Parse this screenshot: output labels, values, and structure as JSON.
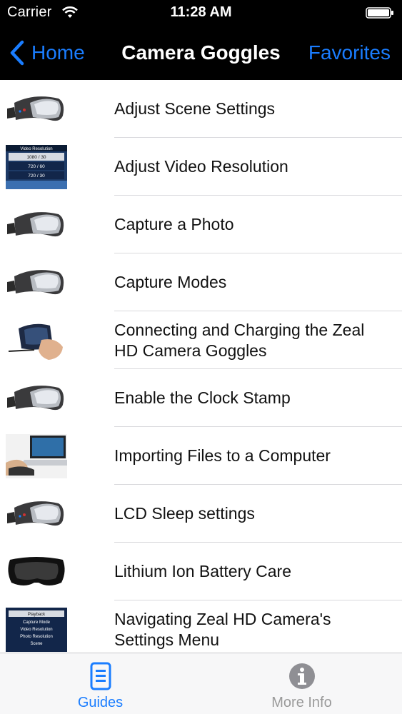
{
  "status_bar": {
    "carrier": "Carrier",
    "time": "11:28 AM"
  },
  "nav": {
    "back_label": "Home",
    "title": "Camera Goggles",
    "right_label": "Favorites"
  },
  "list": {
    "items": [
      {
        "label": "Adjust Scene Settings",
        "thumb": "goggles-icon"
      },
      {
        "label": "Adjust Video Resolution",
        "thumb": "resolution-menu-icon",
        "thumb_text": [
          "Video Resolution",
          "1080 / 30",
          "720 / 60",
          "720 / 30"
        ]
      },
      {
        "label": "Capture a Photo",
        "thumb": "goggles-icon"
      },
      {
        "label": "Capture Modes",
        "thumb": "goggles-icon"
      },
      {
        "label": "Connecting and Charging the Zeal HD Camera Goggles",
        "thumb": "charging-goggles-icon"
      },
      {
        "label": "Enable the Clock Stamp",
        "thumb": "goggles-icon"
      },
      {
        "label": "Importing Files to a Computer",
        "thumb": "laptop-icon"
      },
      {
        "label": "LCD Sleep settings",
        "thumb": "goggles-icon"
      },
      {
        "label": "Lithium Ion Battery Care",
        "thumb": "black-goggles-icon"
      },
      {
        "label": "Navigating Zeal HD Camera's Settings Menu",
        "thumb": "settings-menu-icon",
        "thumb_text": [
          "Playback",
          "Capture Mode",
          "Video Resolution",
          "Photo Resolution",
          "Scene"
        ]
      }
    ]
  },
  "tabbar": {
    "tabs": [
      {
        "label": "Guides",
        "icon": "document-icon",
        "active": true
      },
      {
        "label": "More Info",
        "icon": "info-icon",
        "active": false
      }
    ]
  },
  "colors": {
    "accent": "#1a7dff",
    "bar": "#000000",
    "inactive": "#9a9a9a"
  }
}
